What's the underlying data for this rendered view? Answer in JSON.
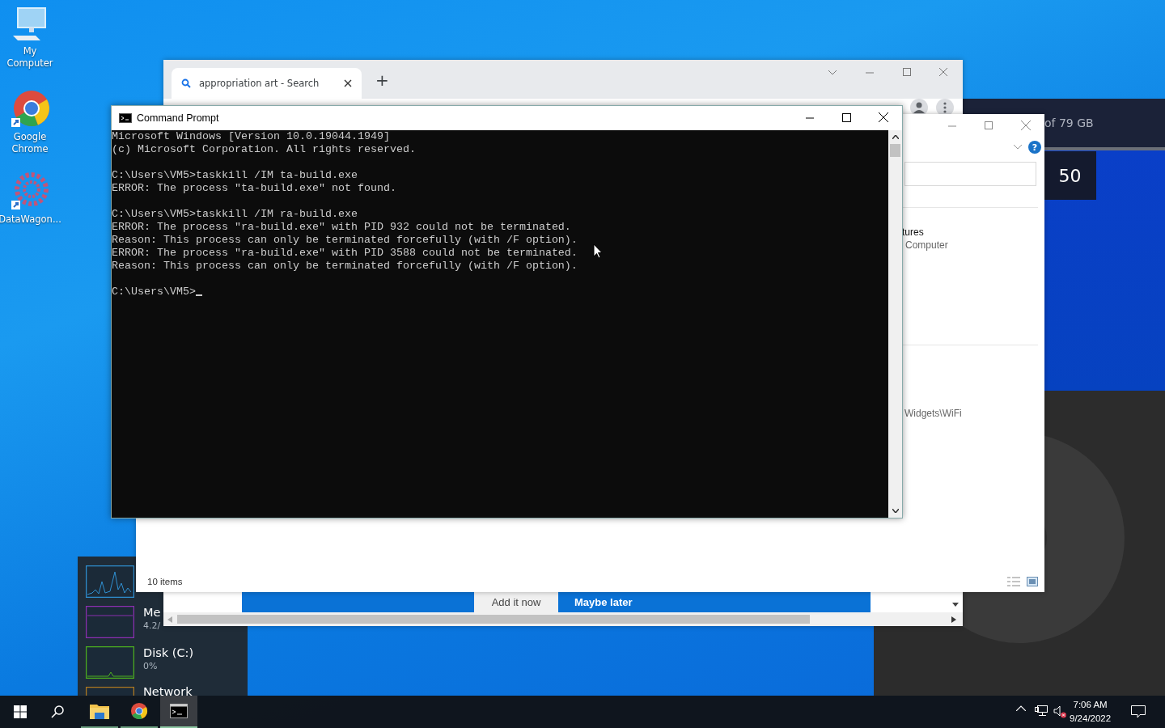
{
  "desktop_icons": [
    {
      "kind": "computer",
      "label": "My Computer"
    },
    {
      "kind": "chrome",
      "label": "Google Chrome"
    },
    {
      "kind": "datawagon",
      "label": "DataWagon..."
    }
  ],
  "media_app": {
    "storage": "of 79 GB",
    "value": "50"
  },
  "browser": {
    "tab_title": "appropriation art - Search",
    "new_tab": "+",
    "banner_buttons": [
      {
        "kind": "secondary",
        "label": "Add it now"
      },
      {
        "kind": "primary",
        "label": "Maybe later"
      }
    ]
  },
  "explorer": {
    "help": "?",
    "texts": [
      {
        "kind": "heading",
        "text": "tures"
      },
      {
        "kind": "sub",
        "text": "Computer"
      },
      {
        "kind": "path",
        "text": "Widgets\\WiFi"
      }
    ],
    "status": "10 items"
  },
  "cmd": {
    "title": "Command Prompt",
    "blocks": [
      [
        "Microsoft Windows [Version 10.0.19044.1949]",
        "(c) Microsoft Corporation. All rights reserved."
      ],
      [
        "C:\\Users\\VM5>taskkill /IM ta-build.exe",
        "ERROR: The process \"ta-build.exe\" not found."
      ],
      [
        "C:\\Users\\VM5>taskkill /IM ra-build.exe",
        "ERROR: The process \"ra-build.exe\" with PID 932 could not be terminated.",
        "Reason: This process can only be terminated forcefully (with /F option).",
        "ERROR: The process \"ra-build.exe\" with PID 3588 could not be terminated.",
        "Reason: This process can only be terminated forcefully (with /F option)."
      ],
      [
        "C:\\Users\\VM5>"
      ]
    ]
  },
  "task_manager": {
    "items": [
      {
        "kind": "cpu",
        "color": "#2f8fd0"
      },
      {
        "kind": "memory",
        "color": "#8b2fb0",
        "title": "Me",
        "detail": "4.2/"
      },
      {
        "kind": "disk",
        "color": "#4caf1f",
        "title": "Disk (C:)",
        "detail": "0%"
      },
      {
        "kind": "network",
        "color": "#b07a20",
        "title": "Network"
      }
    ]
  },
  "taskbar": {
    "apps": [
      {
        "kind": "explorer",
        "selected": false
      },
      {
        "kind": "chrome",
        "selected": false
      },
      {
        "kind": "cmd",
        "selected": true
      }
    ],
    "time": "7:06 AM",
    "date": "9/24/2022"
  }
}
